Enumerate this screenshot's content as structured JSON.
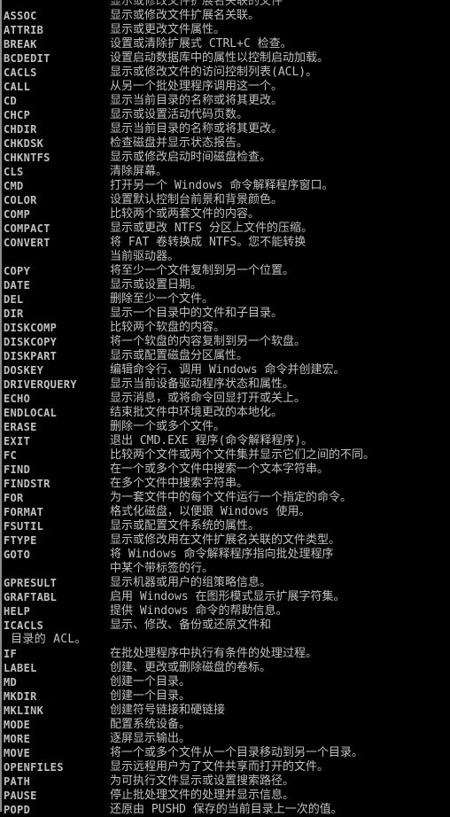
{
  "window": {
    "type": "console",
    "colors": {
      "background": "#000000",
      "foreground": "#c0c0c0"
    }
  },
  "partial_top_line": "显示或修改文件扩展名关联的文件",
  "commands": [
    {
      "name": "ASSOC",
      "desc": "显示或修改文件扩展名关联。"
    },
    {
      "name": "ATTRIB",
      "desc": "显示或更改文件属性。"
    },
    {
      "name": "BREAK",
      "desc": "设置或清除扩展式 CTRL+C 检查。"
    },
    {
      "name": "BCDEDIT",
      "desc": "设置启动数据库中的属性以控制启动加载。"
    },
    {
      "name": "CACLS",
      "desc": "显示或修改文件的访问控制列表(ACL)。"
    },
    {
      "name": "CALL",
      "desc": "从另一个批处理程序调用这一个。"
    },
    {
      "name": "CD",
      "desc": "显示当前目录的名称或将其更改。"
    },
    {
      "name": "CHCP",
      "desc": "显示或设置活动代码页数。"
    },
    {
      "name": "CHDIR",
      "desc": "显示当前目录的名称或将其更改。"
    },
    {
      "name": "CHKDSK",
      "desc": "检查磁盘并显示状态报告。"
    },
    {
      "name": "CHKNTFS",
      "desc": "显示或修改启动时间磁盘检查。"
    },
    {
      "name": "CLS",
      "desc": "清除屏幕。"
    },
    {
      "name": "CMD",
      "desc": "打开另一个 Windows 命令解释程序窗口。"
    },
    {
      "name": "COLOR",
      "desc": "设置默认控制台前景和背景颜色。"
    },
    {
      "name": "COMP",
      "desc": "比较两个或两套文件的内容。"
    },
    {
      "name": "COMPACT",
      "desc": "显示或更改 NTFS 分区上文件的压缩。"
    },
    {
      "name": "CONVERT",
      "desc": "将 FAT 卷转换成 NTFS。您不能转换"
    },
    {
      "name": "",
      "desc": "当前驱动器。"
    },
    {
      "name": "COPY",
      "desc": "将至少一个文件复制到另一个位置。"
    },
    {
      "name": "DATE",
      "desc": "显示或设置日期。"
    },
    {
      "name": "DEL",
      "desc": "删除至少一个文件。"
    },
    {
      "name": "DIR",
      "desc": "显示一个目录中的文件和子目录。"
    },
    {
      "name": "DISKCOMP",
      "desc": "比较两个软盘的内容。"
    },
    {
      "name": "DISKCOPY",
      "desc": "将一个软盘的内容复制到另一个软盘。"
    },
    {
      "name": "DISKPART",
      "desc": "显示或配置磁盘分区属性。"
    },
    {
      "name": "DOSKEY",
      "desc": "编辑命令行、调用 Windows 命令并创建宏。"
    },
    {
      "name": "DRIVERQUERY",
      "desc": "显示当前设备驱动程序状态和属性。"
    },
    {
      "name": "ECHO",
      "desc": "显示消息，或将命令回显打开或关上。"
    },
    {
      "name": "ENDLOCAL",
      "desc": "结束批文件中环境更改的本地化。"
    },
    {
      "name": "ERASE",
      "desc": "删除一个或多个文件。"
    },
    {
      "name": "EXIT",
      "desc": "退出 CMD.EXE 程序(命令解释程序)。"
    },
    {
      "name": "FC",
      "desc": "比较两个文件或两个文件集并显示它们之间的不同。"
    },
    {
      "name": "FIND",
      "desc": "在一个或多个文件中搜索一个文本字符串。"
    },
    {
      "name": "FINDSTR",
      "desc": "在多个文件中搜索字符串。"
    },
    {
      "name": "FOR",
      "desc": "为一套文件中的每个文件运行一个指定的命令。"
    },
    {
      "name": "FORMAT",
      "desc": "格式化磁盘，以便跟 Windows 使用。"
    },
    {
      "name": "FSUTIL",
      "desc": "显示或配置文件系统的属性。"
    },
    {
      "name": "FTYPE",
      "desc": "显示或修改用在文件扩展名关联的文件类型。"
    },
    {
      "name": "GOTO",
      "desc": "将 Windows 命令解释程序指向批处理程序"
    },
    {
      "name": "",
      "desc": "中某个带标签的行。"
    },
    {
      "name": "GPRESULT",
      "desc": "显示机器或用户的组策略信息。"
    },
    {
      "name": "GRAFTABL",
      "desc": "启用 Windows 在图形模式显示扩展字符集。"
    },
    {
      "name": "HELP",
      "desc": "提供 Windows 命令的帮助信息。"
    },
    {
      "name": "ICACLS",
      "desc": "显示、修改、备份或还原文件和"
    },
    {
      "name": " 目录的 ACL。",
      "desc": "",
      "wrap": true
    },
    {
      "name": "IF",
      "desc": "在批处理程序中执行有条件的处理过程。"
    },
    {
      "name": "LABEL",
      "desc": "创建、更改或删除磁盘的卷标。"
    },
    {
      "name": "MD",
      "desc": "创建一个目录。"
    },
    {
      "name": "MKDIR",
      "desc": "创建一个目录。"
    },
    {
      "name": "MKLINK",
      "desc": "创建符号链接和硬链接"
    },
    {
      "name": "MODE",
      "desc": "配置系统设备。"
    },
    {
      "name": "MORE",
      "desc": "逐屏显示输出。"
    },
    {
      "name": "MOVE",
      "desc": "将一个或多个文件从一个目录移动到另一个目录。"
    },
    {
      "name": "OPENFILES",
      "desc": "显示远程用户为了文件共享而打开的文件。"
    },
    {
      "name": "PATH",
      "desc": "为可执行文件显示或设置搜索路径。"
    },
    {
      "name": "PAUSE",
      "desc": "停止批处理文件的处理并显示信息。"
    },
    {
      "name": "POPD",
      "desc": "还原由 PUSHD 保存的当前目录上一次的值。"
    }
  ]
}
